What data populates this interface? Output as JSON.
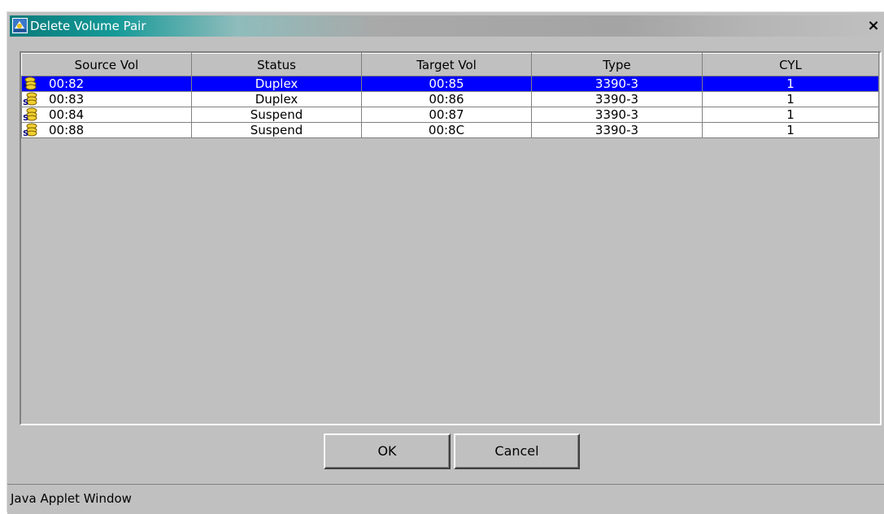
{
  "window": {
    "title": "Delete Volume Pair",
    "close_glyph": "×",
    "title_icon": "java-applet-icon"
  },
  "table": {
    "columns": [
      "Source Vol",
      "Status",
      "Target Vol",
      "Type",
      "CYL"
    ],
    "rows": [
      {
        "icon": "primary-volume-icon",
        "source": "00:82",
        "status": "Duplex",
        "target": "00:85",
        "type": "3390-3",
        "cyl": "1",
        "selected": true
      },
      {
        "icon": "secondary-volume-icon",
        "source": "00:83",
        "status": "Duplex",
        "target": "00:86",
        "type": "3390-3",
        "cyl": "1",
        "selected": false
      },
      {
        "icon": "secondary-volume-icon",
        "source": "00:84",
        "status": "Suspend",
        "target": "00:87",
        "type": "3390-3",
        "cyl": "1",
        "selected": false
      },
      {
        "icon": "secondary-volume-icon",
        "source": "00:88",
        "status": "Suspend",
        "target": "00:8C",
        "type": "3390-3",
        "cyl": "1",
        "selected": false
      }
    ]
  },
  "buttons": {
    "ok_label": "OK",
    "cancel_label": "Cancel"
  },
  "status_bar": {
    "text": "Java Applet Window"
  },
  "colors": {
    "selection": "#0000ff",
    "titlebar_start": "#0a7a7a",
    "window_bg": "#c0c0c0"
  }
}
